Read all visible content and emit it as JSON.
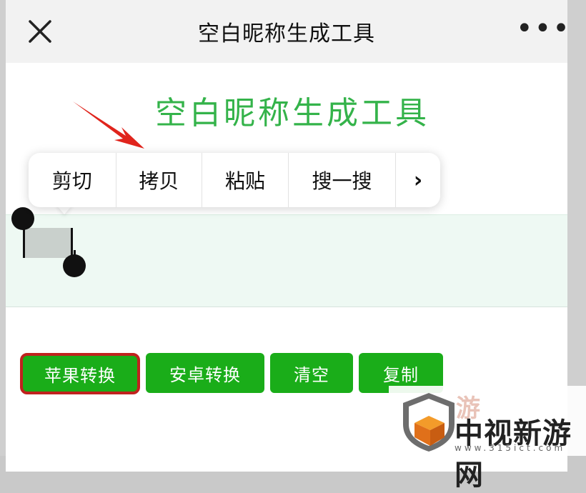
{
  "navbar": {
    "title": "空白昵称生成工具",
    "more": "•••"
  },
  "page": {
    "heading": "空白昵称生成工具"
  },
  "context_menu": {
    "items": [
      "剪切",
      "拷贝",
      "粘贴",
      "搜一搜"
    ],
    "more": "›"
  },
  "buttons": {
    "apple": "苹果转换",
    "android": "安卓转换",
    "clear": "清空",
    "copy": "复制"
  },
  "watermark": {
    "name": "中视新游网",
    "url": "www.315ict.com",
    "ghost": "游"
  },
  "colors": {
    "accent": "#34b34a",
    "button": "#1aad19",
    "highlight_border": "#c0221e",
    "arrow": "#e0241c",
    "textarea_bg": "#eef9f3"
  }
}
